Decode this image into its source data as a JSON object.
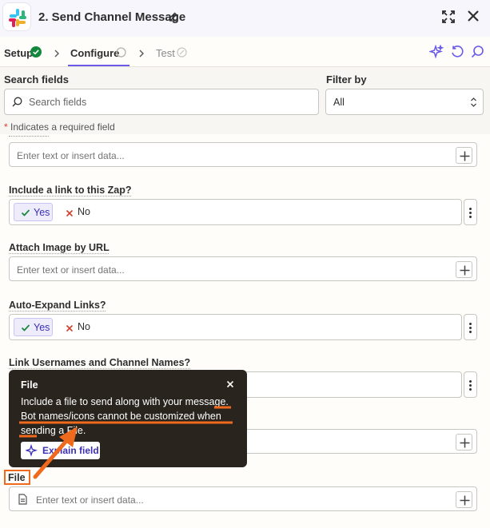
{
  "header": {
    "title": "2. Send Channel Message"
  },
  "tabs": [
    {
      "label": "Setup"
    },
    {
      "label": "Configure"
    },
    {
      "label": "Test"
    }
  ],
  "search": {
    "label": "Search fields",
    "placeholder": "Search fields"
  },
  "filter": {
    "label": "Filter by",
    "value": "All"
  },
  "required_note": {
    "star": "*",
    "text": " Indicates a required field"
  },
  "fields": {
    "top_input_placeholder": "Enter text or insert data...",
    "include_link": {
      "label": "Include a link to this Zap?",
      "yes": "Yes",
      "no": "No"
    },
    "attach_image": {
      "label": "Attach Image by URL",
      "placeholder": "Enter text or insert data..."
    },
    "auto_expand": {
      "label": "Auto-Expand Links?",
      "yes": "Yes",
      "no": "No"
    },
    "link_usernames": {
      "label": "Link Usernames and Channel Names?"
    },
    "file": {
      "label": "File",
      "placeholder": "Enter text or insert data..."
    }
  },
  "tooltip": {
    "title": "File",
    "body": "Include a file to send along with your message. Bot names/icons cannot be customized when sending a File.",
    "button": "Explain field"
  },
  "colors": {
    "accent": "#695be8",
    "success": "#13873c",
    "annotation": "#f06a1d",
    "tooltip_bg": "#29241e"
  }
}
